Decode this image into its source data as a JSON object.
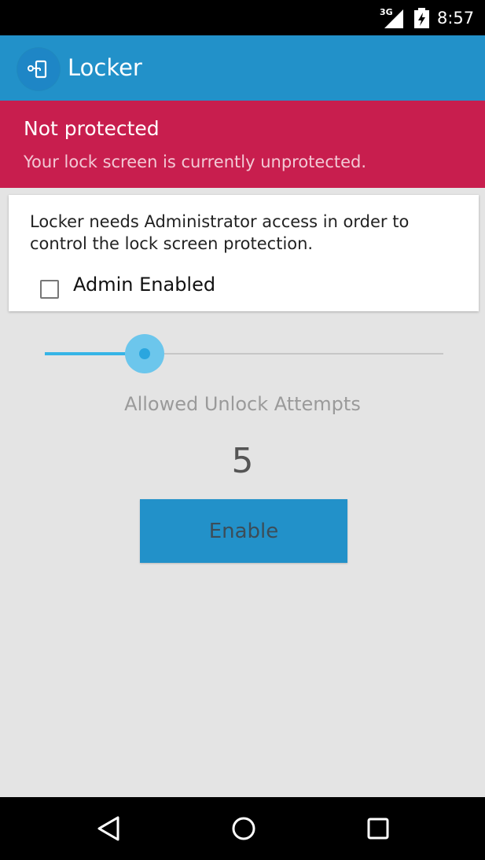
{
  "status_bar": {
    "network_label": "3G",
    "time": "8:57"
  },
  "app_bar": {
    "title": "Locker",
    "logo_icon": "lock-key-icon",
    "color": "#2291c9"
  },
  "banner": {
    "title": "Not protected",
    "message": "Your lock screen is currently unprotected.",
    "color": "#c81e4e"
  },
  "admin_card": {
    "description": "Locker needs Administrator access in order to control the lock screen protection.",
    "checkbox_label": "Admin Enabled",
    "checkbox_checked": false
  },
  "unlock_attempts": {
    "slider_fraction": 0.25,
    "label": "Allowed Unlock Attempts",
    "value": "5"
  },
  "enable_button": {
    "label": "Enable"
  },
  "nav_bar": {
    "icons": [
      "back-icon",
      "home-icon",
      "recents-icon"
    ]
  }
}
